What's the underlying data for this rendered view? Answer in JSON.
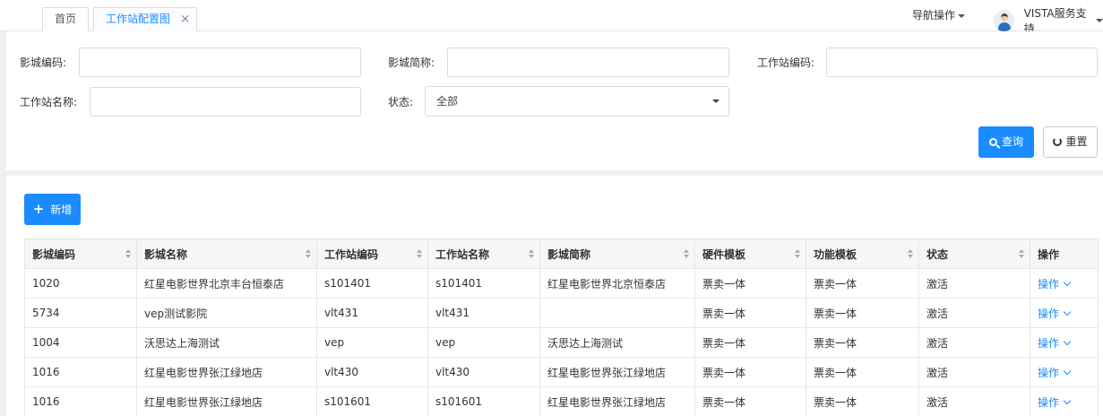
{
  "tabs": [
    {
      "label": "首页"
    },
    {
      "label": "工作站配置图",
      "close": "×"
    }
  ],
  "header": {
    "nav_ops": "导航操作",
    "user_name": "VISTA服务支持"
  },
  "filters": {
    "cinema_code_label": "影城编码:",
    "cinema_short_label": "影城简称:",
    "station_code_label": "工作站编码:",
    "station_name_label": "工作站名称:",
    "status_label": "状态:",
    "status_value": "全部",
    "query_label": "查询",
    "reset_label": "重置"
  },
  "toolbar": {
    "add_label": "新增"
  },
  "table": {
    "columns": [
      "影城编码",
      "影城名称",
      "工作站编码",
      "工作站名称",
      "影城简称",
      "硬件模板",
      "功能模板",
      "状态",
      "操作"
    ],
    "rows": [
      [
        "1020",
        "红星电影世界北京丰台恒泰店",
        "s101401",
        "s101401",
        "红星电影世界北京恒泰店",
        "票卖一体",
        "票卖一体",
        "激活",
        "操作"
      ],
      [
        "5734",
        "vep测试影院",
        "vlt431",
        "vlt431",
        "",
        "票卖一体",
        "票卖一体",
        "激活",
        "操作"
      ],
      [
        "1004",
        "沃思达上海测试",
        "vep",
        "vep",
        "沃思达上海测试",
        "票卖一体",
        "票卖一体",
        "激活",
        "操作"
      ],
      [
        "1016",
        "红星电影世界张江绿地店",
        "vlt430",
        "vlt430",
        "红星电影世界张江绿地店",
        "票卖一体",
        "票卖一体",
        "激活",
        "操作"
      ],
      [
        "1016",
        "红星电影世界张江绿地店",
        "s101601",
        "s101601",
        "红星电影世界张江绿地店",
        "票卖一体",
        "票卖一体",
        "激活",
        "操作"
      ]
    ]
  },
  "colors": {
    "accent": "#1a8cff"
  }
}
